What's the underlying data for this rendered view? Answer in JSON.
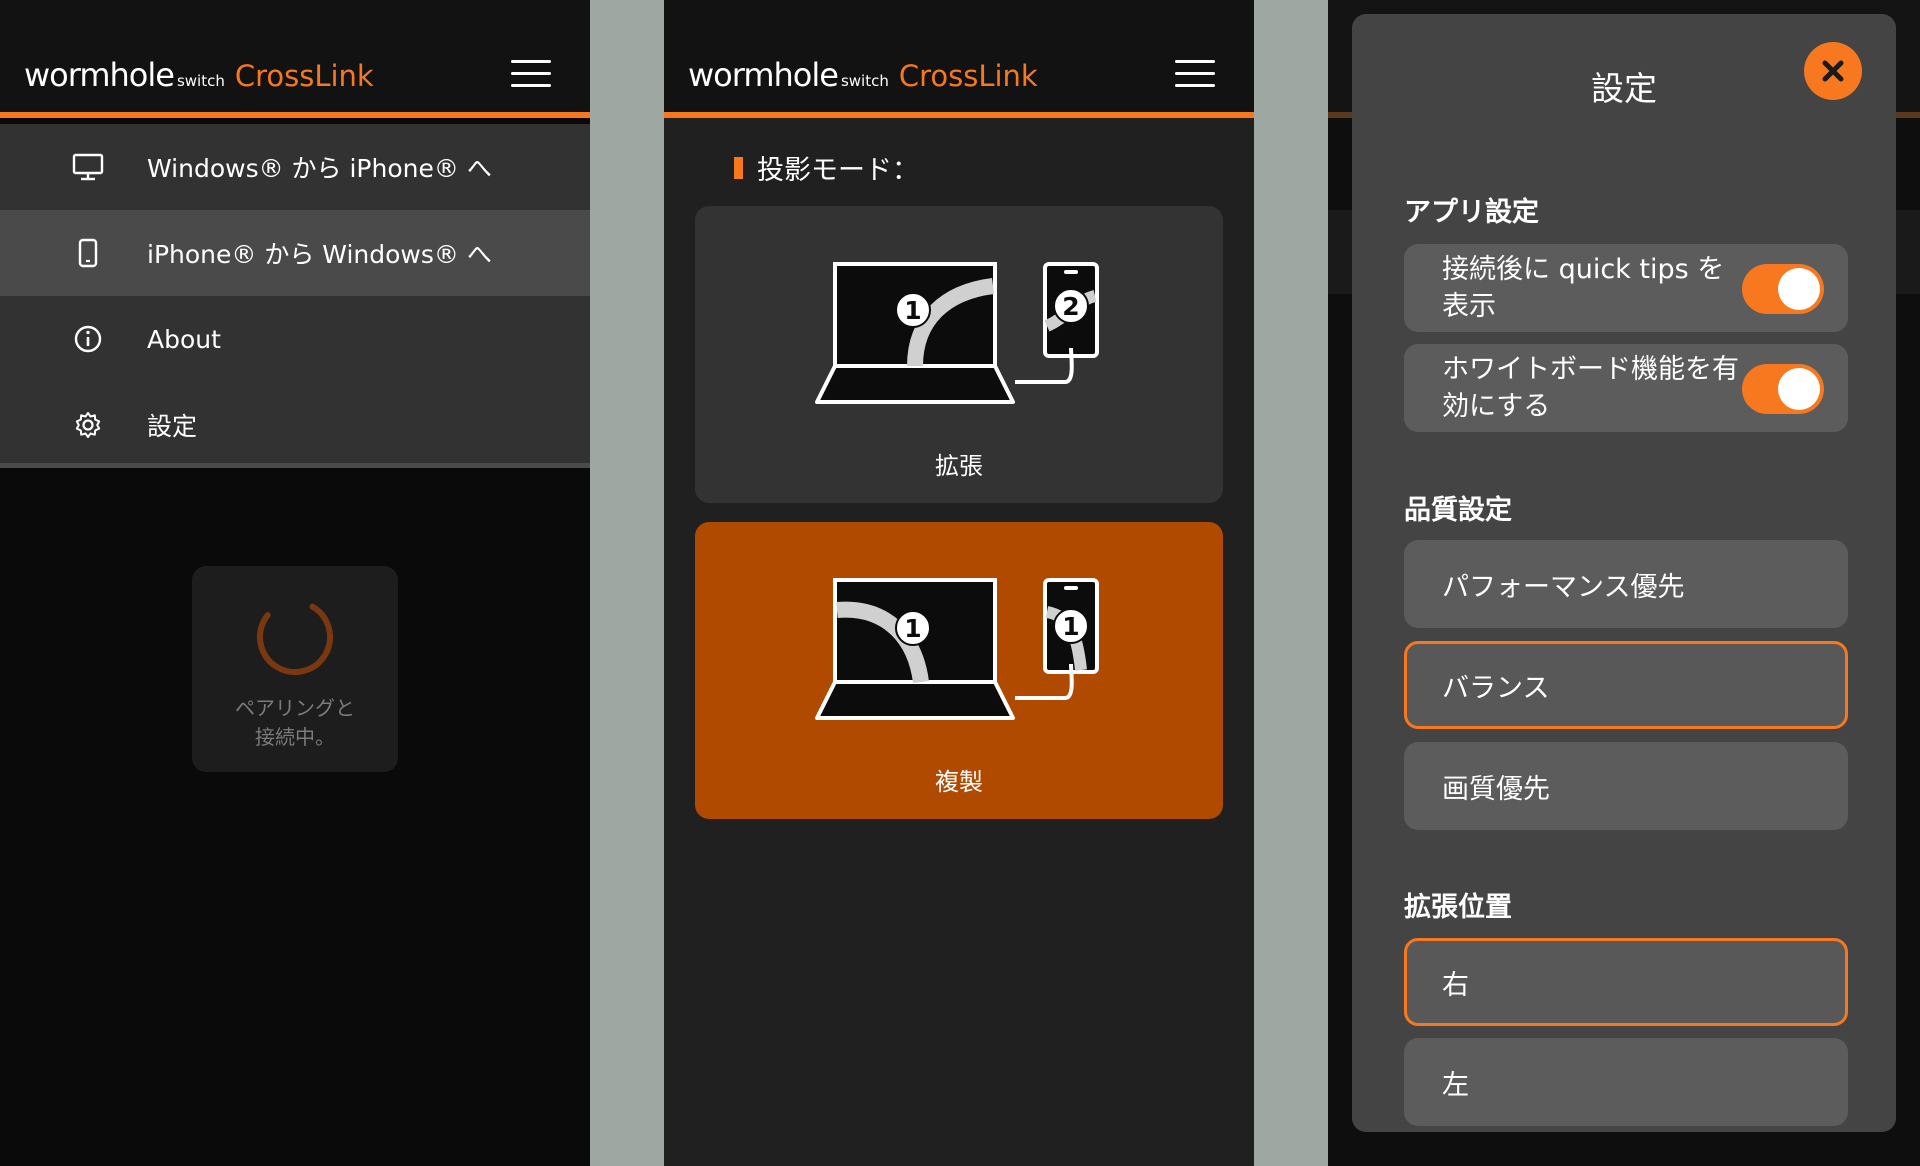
{
  "header": {
    "logo_main": "wormhole",
    "logo_small": "switch",
    "logo_product": "CrossLink"
  },
  "menu": {
    "items": [
      {
        "label": "Windows® から iPhone® へ",
        "icon": "monitor-icon"
      },
      {
        "label": "iPhone® から Windows® へ",
        "icon": "phone-icon"
      },
      {
        "label": "About",
        "icon": "info-icon"
      },
      {
        "label": "設定",
        "icon": "gear-icon"
      }
    ]
  },
  "pairing": {
    "text_line1": "ペアリングと",
    "text_line2": "接続中。"
  },
  "projection": {
    "title": "投影モード：",
    "modes": [
      {
        "label": "拡張",
        "laptop_number": "1",
        "phone_number": "2"
      },
      {
        "label": "複製",
        "laptop_number": "1",
        "phone_number": "1"
      }
    ]
  },
  "settings": {
    "title": "設定",
    "app_section": {
      "title": "アプリ設定",
      "toggles": [
        {
          "label": "接続後に quick tips を表示"
        },
        {
          "label": "ホワイトボード機能を有効にする"
        }
      ]
    },
    "quality_section": {
      "title": "品質設定",
      "options": [
        "パフォーマンス優先",
        "バランス",
        "画質優先"
      ],
      "selected": "バランス"
    },
    "position_section": {
      "title": "拡張位置",
      "options": [
        "右",
        "左"
      ],
      "selected": "右"
    }
  },
  "colors": {
    "accent": "#f7781f",
    "selected_card": "#b04a00"
  }
}
